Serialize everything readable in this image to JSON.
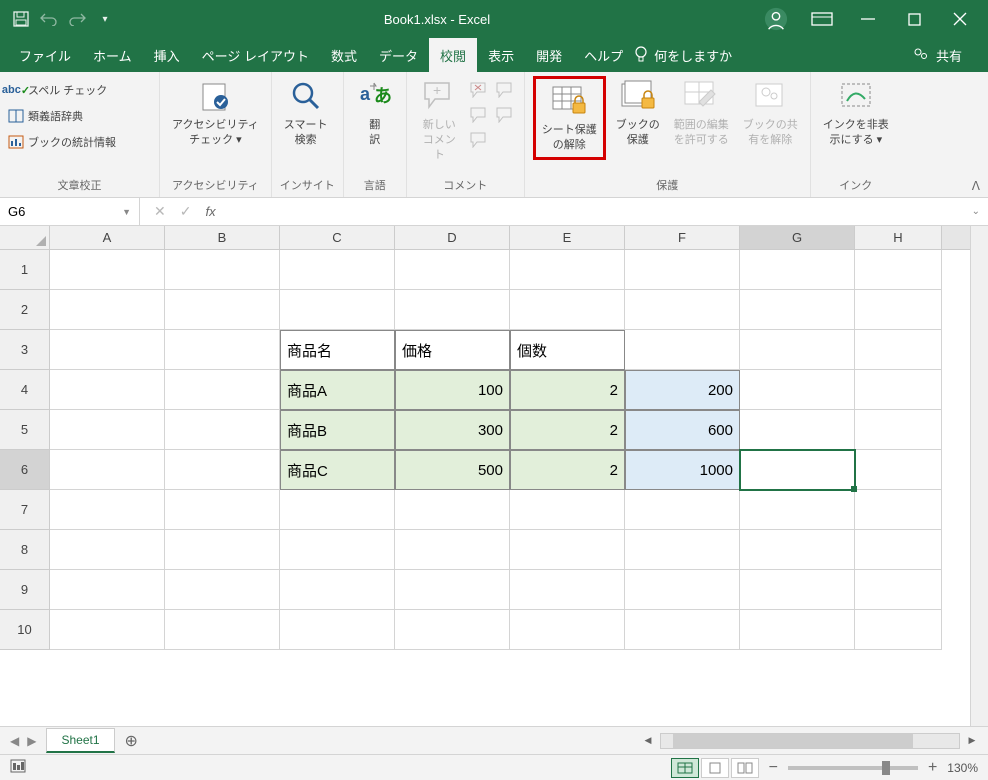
{
  "title": "Book1.xlsx - Excel",
  "menubar": {
    "file": "ファイル",
    "home": "ホーム",
    "insert": "挿入",
    "page_layout": "ページ レイアウト",
    "formulas": "数式",
    "data": "データ",
    "review": "校閲",
    "view": "表示",
    "developer": "開発",
    "help": "ヘルプ",
    "tell_me": "何をしますか",
    "share": "共有"
  },
  "ribbon": {
    "proofing": {
      "spell": "スペル チェック",
      "thesaurus": "類義語辞典",
      "stats": "ブックの統計情報",
      "label": "文章校正"
    },
    "accessibility": {
      "btn": "アクセシビリティ\nチェック ▾",
      "label": "アクセシビリティ"
    },
    "insights": {
      "btn": "スマート\n検索",
      "label": "インサイト"
    },
    "language": {
      "btn": "翻\n訳",
      "label": "言語"
    },
    "comments": {
      "btn": "新しい\nコメント",
      "label": "コメント"
    },
    "protect": {
      "sheet": "シート保護\nの解除",
      "workbook": "ブックの\n保護",
      "ranges": "範囲の編集\nを許可する",
      "unshare": "ブックの共\n有を解除",
      "label": "保護"
    },
    "ink": {
      "btn": "インクを非表\n示にする ▾",
      "label": "インク"
    }
  },
  "namebox": "G6",
  "columns": [
    "A",
    "B",
    "C",
    "D",
    "E",
    "F",
    "G",
    "H"
  ],
  "row_numbers": [
    "1",
    "2",
    "3",
    "4",
    "5",
    "6",
    "7",
    "8",
    "9",
    "10"
  ],
  "cells": {
    "C3": "商品名",
    "D3": "価格",
    "E3": "個数",
    "C4": "商品A",
    "D4": "100",
    "E4": "2",
    "F4": "200",
    "C5": "商品B",
    "D5": "300",
    "E5": "2",
    "F5": "600",
    "C6": "商品C",
    "D6": "500",
    "E6": "2",
    "F6": "1000"
  },
  "sheet_tab": "Sheet1",
  "zoom": "130%"
}
